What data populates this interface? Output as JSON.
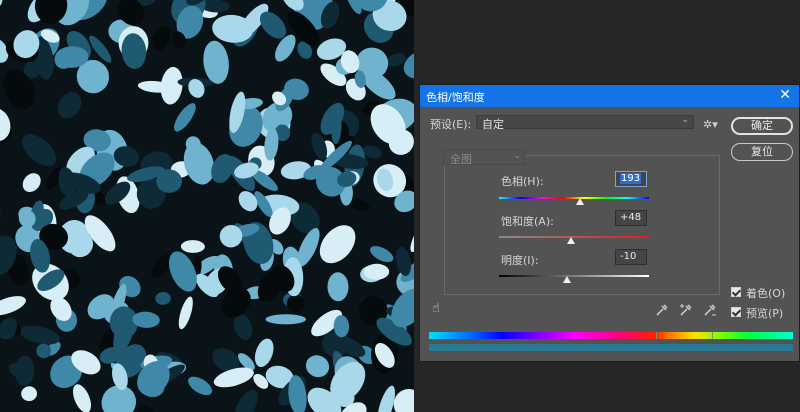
{
  "dialog": {
    "title": "色相/饱和度",
    "close_glyph": "✕",
    "preset_label": "预设(E):",
    "preset_value": "自定",
    "ok_label": "确定",
    "reset_label": "复位",
    "channel_value": "全图",
    "hue": {
      "label": "色相(H):",
      "value": "193",
      "position": 0.54
    },
    "saturation": {
      "label": "饱和度(A):",
      "value": "+48",
      "position": 0.48
    },
    "lightness": {
      "label": "明度(I):",
      "value": "-10",
      "position": 0.45
    },
    "colorize_label": "着色(O)",
    "colorize_checked": true,
    "preview_label": "预览(P)",
    "preview_checked": true,
    "icons": {
      "settings": "gear-icon",
      "targeted_adjust": "hand-scrub-icon",
      "eyedropper": "eyedropper-icon",
      "eyedropper_add": "eyedropper-plus-icon",
      "eyedropper_subtract": "eyedropper-minus-icon"
    }
  },
  "colors": {
    "titlebar": "#1473e6",
    "dialog_bg": "#535353",
    "workspace_bg": "#262626",
    "colorized_bar": "#2a7a96"
  }
}
